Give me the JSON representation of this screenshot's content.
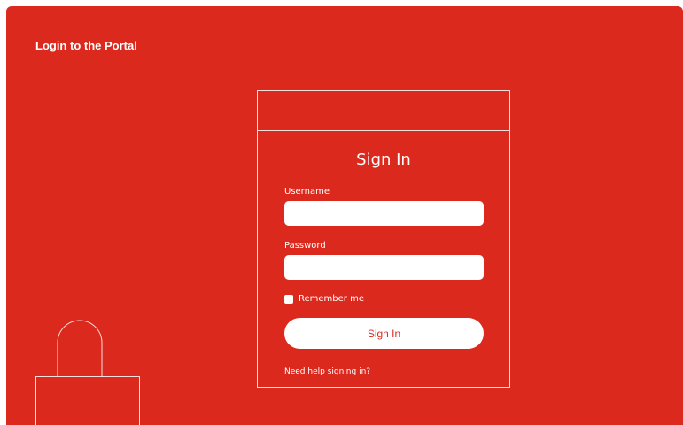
{
  "header": {
    "title": "Login to the Portal"
  },
  "signin": {
    "title": "Sign In",
    "username_label": "Username",
    "username_value": "",
    "password_label": "Password",
    "password_value": "",
    "remember_label": "Remember me",
    "remember_checked": false,
    "submit_label": "Sign In",
    "help_link": "Need help signing in?"
  },
  "colors": {
    "brand_red": "#dc291e",
    "text": "#ffffff"
  },
  "icons": {
    "illustration": "padlock-outline"
  }
}
